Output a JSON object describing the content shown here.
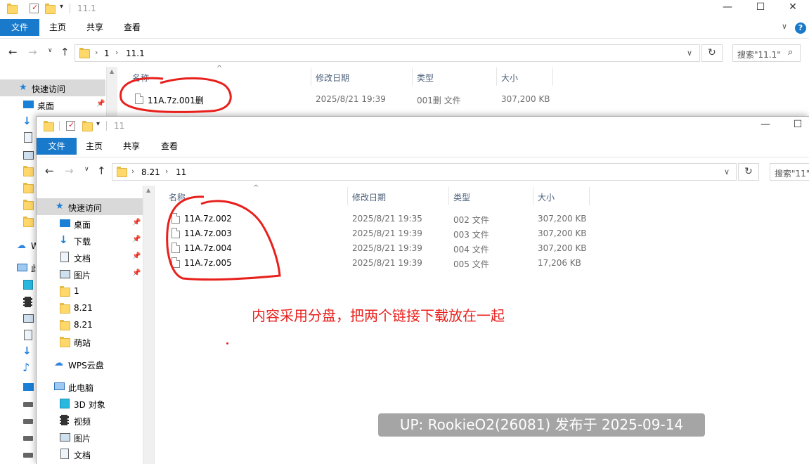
{
  "back_window": {
    "title": "11.1",
    "tabs": [
      "文件",
      "主页",
      "共享",
      "查看"
    ],
    "path": [
      "1",
      "11.1"
    ],
    "search_placeholder": "搜索\"11.1\"",
    "columns": [
      "名称",
      "修改日期",
      "类型",
      "大小"
    ],
    "files": [
      {
        "name": "11A.7z.001删",
        "date": "2025/8/21 19:39",
        "type": "001删 文件",
        "size": "307,200 KB"
      }
    ],
    "nav": {
      "quick_access": "快速访问",
      "desktop": "桌面"
    }
  },
  "front_window": {
    "title": "11",
    "tabs": [
      "文件",
      "主页",
      "共享",
      "查看"
    ],
    "path": [
      "8.21",
      "11"
    ],
    "search_placeholder": "搜索\"11\"",
    "columns": [
      "名称",
      "修改日期",
      "类型",
      "大小"
    ],
    "files": [
      {
        "name": "11A.7z.002",
        "date": "2025/8/21 19:35",
        "type": "002 文件",
        "size": "307,200 KB"
      },
      {
        "name": "11A.7z.003",
        "date": "2025/8/21 19:39",
        "type": "003 文件",
        "size": "307,200 KB"
      },
      {
        "name": "11A.7z.004",
        "date": "2025/8/21 19:39",
        "type": "004 文件",
        "size": "307,200 KB"
      },
      {
        "name": "11A.7z.005",
        "date": "2025/8/21 19:39",
        "type": "005 文件",
        "size": "17,206 KB"
      }
    ],
    "nav": {
      "quick_access": "快速访问",
      "desktop": "桌面",
      "downloads": "下载",
      "documents": "文档",
      "pictures": "图片",
      "f1": "1",
      "f2": "8.21",
      "f3": "8.21",
      "f4": "萌站",
      "wps": "WPS云盘",
      "this_pc": "此电脑",
      "objects3d": "3D 对象",
      "videos": "视频",
      "pictures2": "图片",
      "documents2": "文档"
    },
    "back_nav_peek": {
      "wps": "W",
      "pc": "此"
    }
  },
  "annotation": "内容采用分盘，把两个链接下载放在一起",
  "watermark": "UP: RookieO2(26081) 发布于 2025-09-14",
  "colors": {
    "file_tab": "#1979ca",
    "annotation": "#e8201c",
    "help": "#1979ca"
  }
}
